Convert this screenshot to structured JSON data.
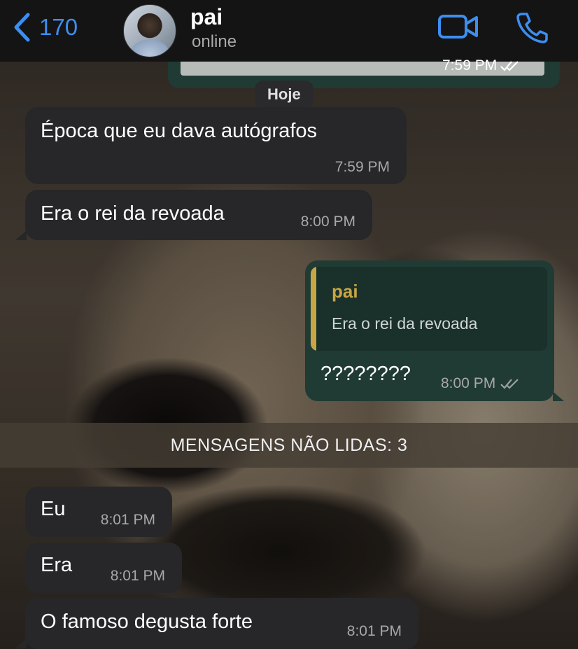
{
  "header": {
    "back_count": "170",
    "contact_name": "pai",
    "contact_status": "online"
  },
  "previous_message": {
    "time": "7:59 PM"
  },
  "date_separator": "Hoje",
  "messages": [
    {
      "direction": "in",
      "text": "Época que eu dava autógrafos",
      "time": "7:59 PM"
    },
    {
      "direction": "in",
      "text": "Era o rei da revoada",
      "time": "8:00 PM"
    },
    {
      "direction": "out",
      "quote_author": "pai",
      "quote_text": "Era o rei da revoada",
      "text": "????????",
      "time": "8:00 PM"
    },
    {
      "direction": "in",
      "text": "Eu",
      "time": "8:01 PM"
    },
    {
      "direction": "in",
      "text": "Era",
      "time": "8:01 PM"
    },
    {
      "direction": "in",
      "text": "O famoso degusta forte",
      "time": "8:01 PM"
    }
  ],
  "unread_banner": "MENSAGENS NÃO LIDAS: 3",
  "colors": {
    "accent": "#3d8ef0",
    "incoming_bubble": "#272729",
    "outgoing_bubble": "#1f3b33",
    "quote_accent": "#c9a644"
  },
  "icons": [
    "chevron-left-icon",
    "video-call-icon",
    "phone-icon",
    "double-check-icon"
  ]
}
